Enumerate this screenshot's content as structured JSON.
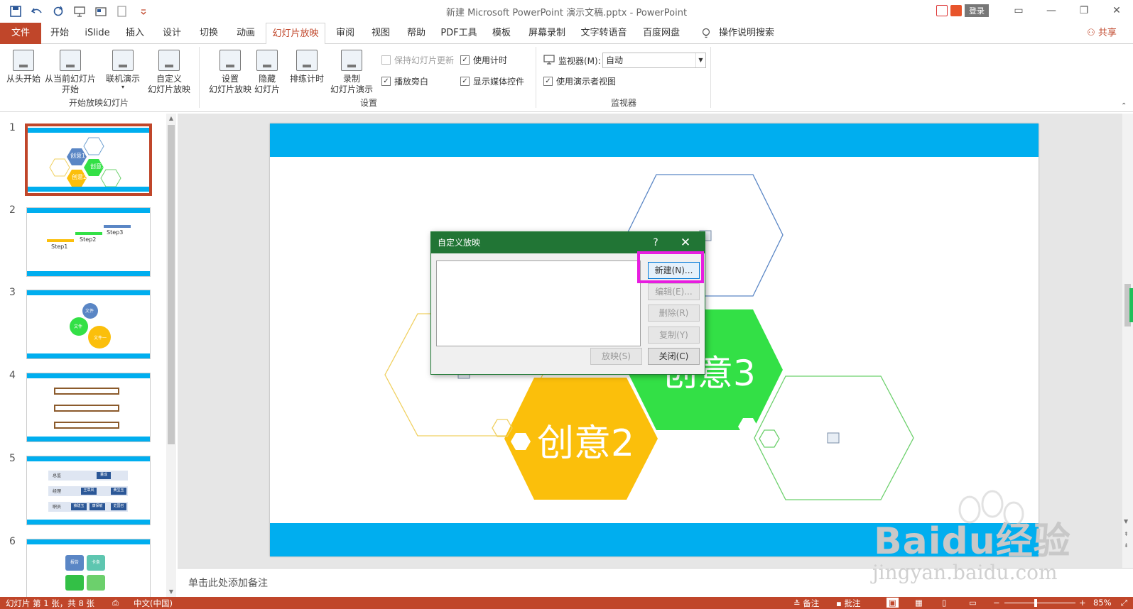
{
  "window": {
    "title": "新建 Microsoft PowerPoint 演示文稿.pptx  -  PowerPoint",
    "account_label": "登录"
  },
  "tabs": [
    "文件",
    "开始",
    "iSlide",
    "插入",
    "设计",
    "切换",
    "动画",
    "幻灯片放映",
    "审阅",
    "视图",
    "帮助",
    "PDF工具",
    "模板",
    "屏幕录制",
    "文字转语音",
    "百度网盘",
    "操作说明搜索"
  ],
  "share_label": "共享",
  "ribbon": {
    "from_beginning": "从头开始",
    "from_current_1": "从当前幻灯片",
    "from_current_2": "开始",
    "online_present": "联机演示",
    "custom_show_1": "自定义",
    "custom_show_2": "幻灯片放映",
    "group_start": "开始放映幻灯片",
    "setup_1": "设置",
    "setup_2": "幻灯片放映",
    "hide_1": "隐藏",
    "hide_2": "幻灯片",
    "rehearse": "排练计时",
    "record_1": "录制",
    "record_2": "幻灯片演示",
    "keep_updated": "保持幻灯片更新",
    "use_timings": "使用计时",
    "play_narrations": "播放旁白",
    "show_media": "显示媒体控件",
    "group_setup": "设置",
    "monitor_label": "监视器(M):",
    "monitor_value": "自动",
    "presenter_view": "使用演示者视图",
    "group_monitor": "监视器"
  },
  "thumbnails": {
    "numbers": [
      "1",
      "2",
      "3",
      "4",
      "5",
      "6"
    ],
    "slide1_labels": [
      "创意1",
      "创意3",
      "创意2"
    ],
    "slide2_labels": [
      "Step1",
      "Step2",
      "Step3"
    ],
    "slide3_labels": [
      "文件",
      "文件",
      "文件一"
    ],
    "slide5_rows": [
      "总监",
      "经理",
      "职员"
    ],
    "slide5_boxes": [
      "董成",
      "王章风",
      "黄宝玉",
      "薛建玉",
      "康保敏",
      "史国召"
    ],
    "slide6_labels": [
      "报告",
      "卡条"
    ]
  },
  "slide": {
    "hex2_text": "创意2",
    "hex3_text": "创意3"
  },
  "notes_placeholder": "单击此处添加备注",
  "dialog": {
    "title": "自定义放映",
    "help": "?",
    "close": "✕",
    "new_btn": "新建(N)...",
    "edit_btn": "编辑(E)...",
    "delete_btn": "删除(R)",
    "copy_btn": "复制(Y)",
    "show_btn": "放映(S)",
    "close_btn": "关闭(C)"
  },
  "status": {
    "slide_info": "幻灯片 第 1 张，共 8 张",
    "language": "中文(中国)",
    "notes": "备注",
    "comments": "批注",
    "zoom": "85%"
  },
  "watermark": {
    "brand": "Baidu经验",
    "url": "jingyan.baidu.com"
  },
  "colors": {
    "accent": "#c0462a",
    "dialog_header": "#217535",
    "slide_bar": "#00aeef",
    "hex_green": "#33e046",
    "hex_yellow": "#fbbf0b",
    "highlight": "#e81ce0"
  }
}
